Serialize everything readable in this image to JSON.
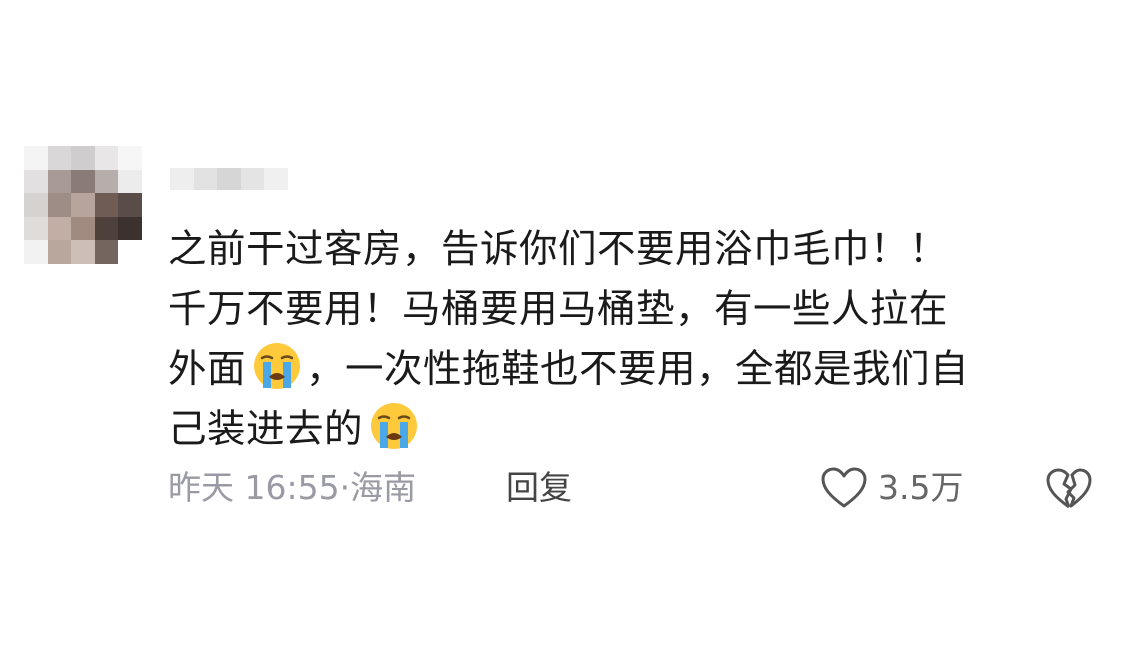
{
  "comment": {
    "lines": [
      "之前干过客房，告诉你们不要用浴巾毛巾！！",
      "千万不要用！马桶要用马桶垫，有一些人拉在",
      "外面",
      "，一次性拖鞋也不要用，全都是我们自",
      "己装进去的"
    ],
    "emoji": "loudly-crying-face",
    "timestamp": "昨天 16:55",
    "separator": "·",
    "location": "海南",
    "reply_label": "回复",
    "like_count": "3.5万"
  },
  "colors": {
    "text": "#1a1a1a",
    "meta": "#9a9aa4",
    "icon": "#555555",
    "emoji_face": "#ffc93c",
    "emoji_tears": "#4aa8e8"
  }
}
